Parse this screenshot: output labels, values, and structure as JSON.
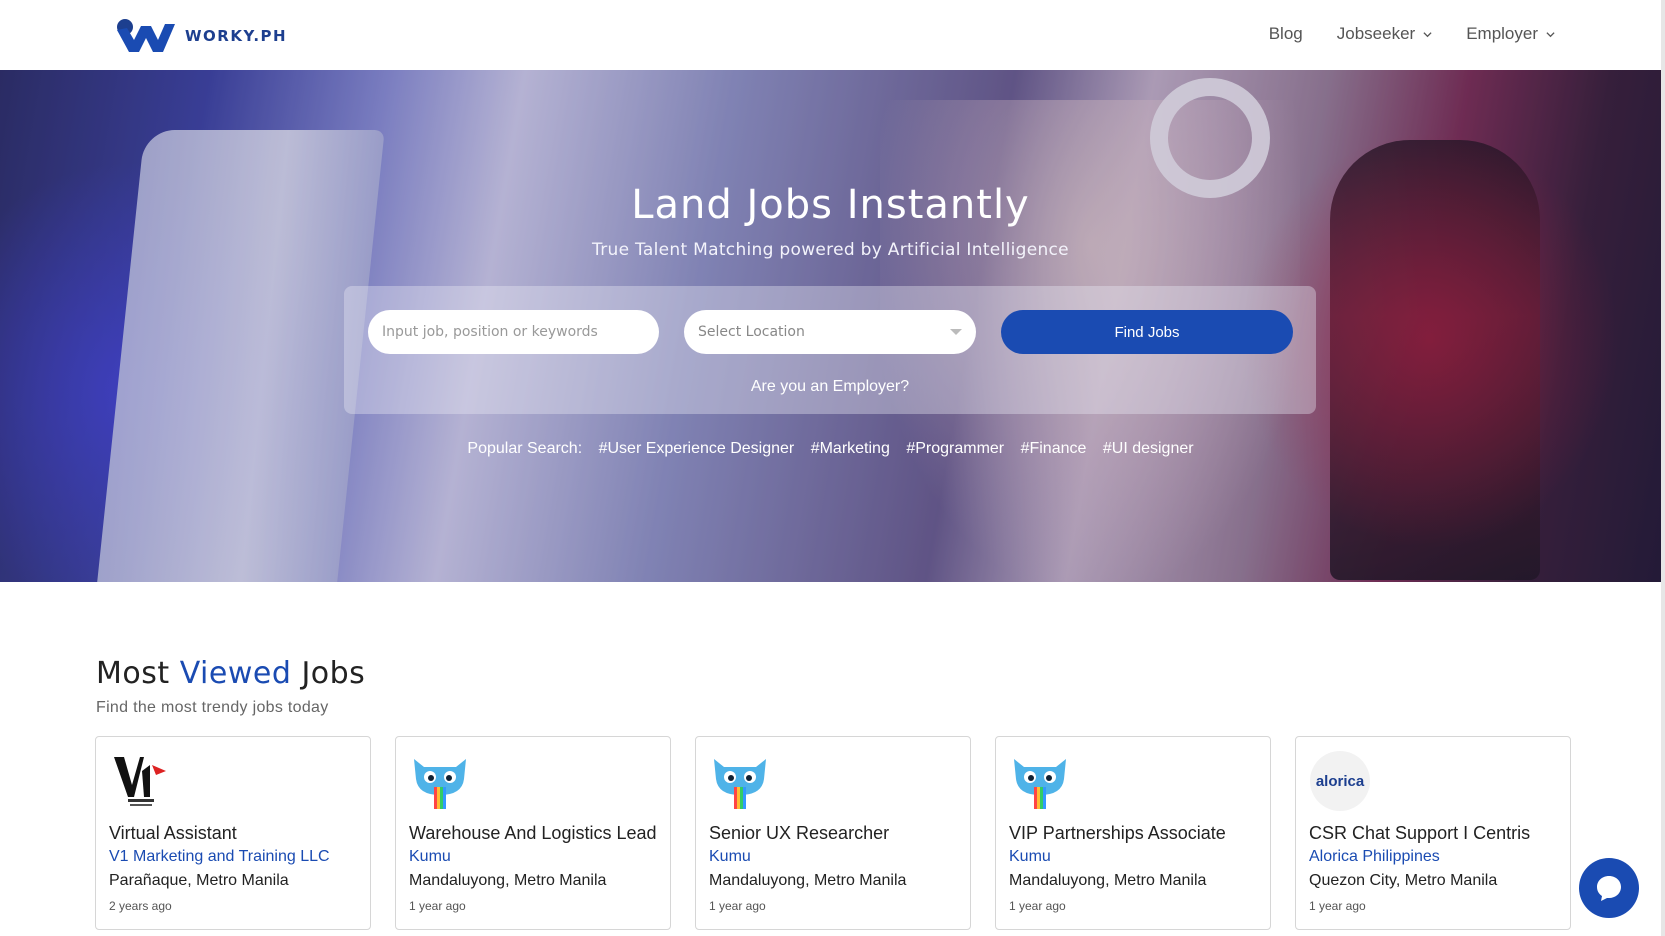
{
  "brand": {
    "name": "WORKY.PH",
    "primary_color": "#1a4bb2"
  },
  "nav": [
    {
      "label": "Blog",
      "has_dropdown": false
    },
    {
      "label": "Jobseeker",
      "has_dropdown": true
    },
    {
      "label": "Employer",
      "has_dropdown": true
    }
  ],
  "hero": {
    "title": "Land Jobs Instantly",
    "subtitle": "True Talent Matching powered by Artificial Intelligence",
    "keyword_placeholder": "Input job, position or keywords",
    "location_value": "Select Location",
    "find_button": "Find Jobs",
    "employer_link": "Are you an Employer?",
    "popular_label": "Popular Search:",
    "popular_tags": [
      "#User Experience Designer",
      "#Marketing",
      "#Programmer",
      "#Finance",
      "#UI designer"
    ]
  },
  "most_viewed": {
    "title_pre": "Most",
    "title_accent": "Viewed",
    "title_post": "Jobs",
    "subtitle": "Find the most trendy jobs today",
    "jobs": [
      {
        "title": "Virtual Assistant",
        "company": "V1 Marketing and Training LLC",
        "location": "Parañaque, Metro Manila",
        "posted": "2 years ago",
        "logo": "v1-marketing-logo",
        "logo_text": "V1"
      },
      {
        "title": "Warehouse And Logistics Lead",
        "company": "Kumu",
        "location": "Mandaluyong, Metro Manila",
        "posted": "1 year ago",
        "logo": "kumu-logo",
        "logo_text": ""
      },
      {
        "title": "Senior UX Researcher",
        "company": "Kumu",
        "location": "Mandaluyong, Metro Manila",
        "posted": "1 year ago",
        "logo": "kumu-logo",
        "logo_text": ""
      },
      {
        "title": "VIP Partnerships Associate",
        "company": "Kumu",
        "location": "Mandaluyong, Metro Manila",
        "posted": "1 year ago",
        "logo": "kumu-logo",
        "logo_text": ""
      },
      {
        "title": "CSR Chat Support I Centris",
        "company": "Alorica Philippines",
        "location": "Quezon City, Metro Manila",
        "posted": "1 year ago",
        "logo": "alorica-logo",
        "logo_text": "alorica"
      }
    ]
  },
  "chat_widget": {
    "icon": "chat-bubble-icon"
  }
}
